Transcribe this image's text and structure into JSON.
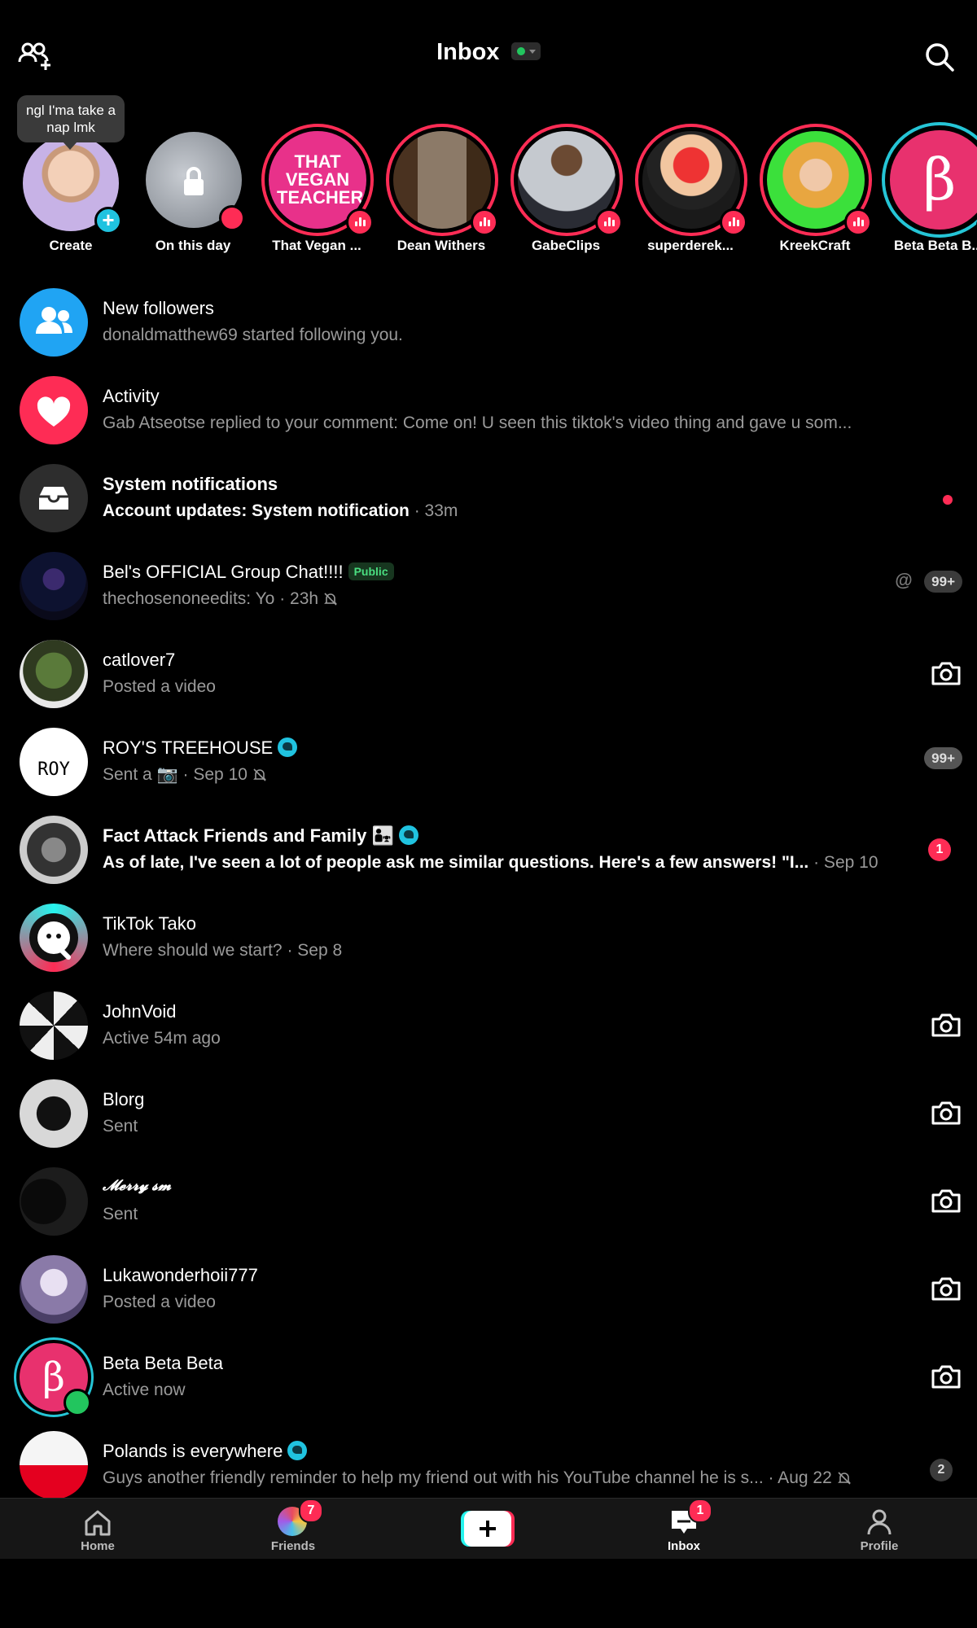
{
  "header": {
    "title": "Inbox"
  },
  "tooltip": {
    "text": "ngl I'ma take a nap lmk"
  },
  "stories": [
    {
      "label": "Create"
    },
    {
      "label": "On this day"
    },
    {
      "label": "That Vegan ...",
      "pic_text": "THAT VEGAN TEACHER"
    },
    {
      "label": "Dean Withers"
    },
    {
      "label": "GabeClips"
    },
    {
      "label": "superderek..."
    },
    {
      "label": "KreekCraft"
    },
    {
      "label": "Beta Beta B...",
      "pic_text": "β"
    }
  ],
  "rows": [
    {
      "name": "New followers",
      "sub": "donaldmatthew69 started following you."
    },
    {
      "name": "Activity",
      "sub": "Gab Atseotse replied to your comment: Come on! U seen this tiktok's video thing and gave u som..."
    },
    {
      "name": "System notifications",
      "sub": "Account updates: System notification",
      "time": "· 33m"
    },
    {
      "name": "Bel's OFFICIAL Group Chat!!!!",
      "tag": "Public",
      "sub": "thechosenoneedits: Yo · 23h",
      "at": "@",
      "count": "99+"
    },
    {
      "name": "catlover7",
      "sub": "Posted a video"
    },
    {
      "name": "ROY'S TREEHOUSE",
      "sub": "Sent a 📷",
      "time": "· Sep 10",
      "count": "99+",
      "avatar_text": "ROY"
    },
    {
      "name": "Fact Attack Friends and Family",
      "emoji": "👨‍👧",
      "sub": "As of late, I've seen a lot of people ask me similar questions. Here's a few answers!  \"I...",
      "time": "· Sep 10",
      "count": "1"
    },
    {
      "name": "TikTok Tako",
      "sub": "Where should we start?",
      "time": "· Sep 8"
    },
    {
      "name": "JohnVoid",
      "sub": "Active 54m ago"
    },
    {
      "name": "Blorg",
      "sub": "Sent"
    },
    {
      "name": "𝓜𝓮𝓻𝓻𝔂 𝓼𝓶",
      "sub": "Sent"
    },
    {
      "name": "Lukawonderhoii777",
      "sub": "Posted a video"
    },
    {
      "name": "Beta Beta Beta",
      "sub": "Active now",
      "avatar_text": "β"
    },
    {
      "name": "Polands is everywhere",
      "sub": "Guys another friendly reminder to help my friend out with his YouTube channel he is s...",
      "time": "· Aug 22",
      "count": "2"
    }
  ],
  "tabbar": {
    "home": "Home",
    "friends": "Friends",
    "friends_badge": "7",
    "create": "+",
    "inbox": "Inbox",
    "inbox_badge": "1",
    "profile": "Profile"
  },
  "colors": {
    "accent": "#fe2c55",
    "teal": "#20c3e0",
    "online": "#22c55e",
    "background": "#000000"
  }
}
